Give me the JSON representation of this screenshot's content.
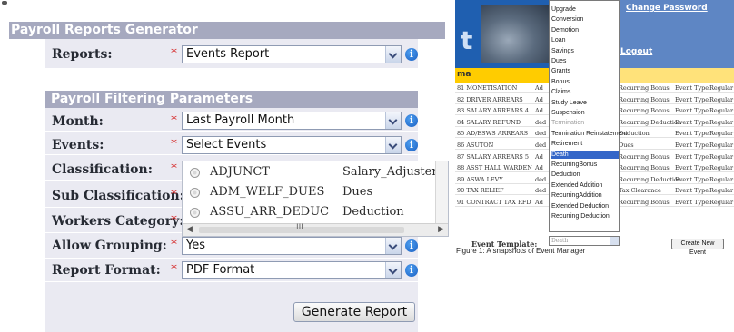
{
  "generator": {
    "title": "Payroll Reports Generator",
    "reports_label": "Reports:",
    "reports_value": "Events Report",
    "filter_title": "Payroll Filtering Parameters",
    "required_mark": "*",
    "info_glyph": "i",
    "fields": {
      "month": {
        "label": "Month:",
        "value": "Last Payroll Month"
      },
      "events": {
        "label": "Events:",
        "value": "Select Events"
      },
      "classification": {
        "label": "Classification:"
      },
      "sub_classification": {
        "label": "Sub Classification:"
      },
      "workers_category": {
        "label": "Workers Category:"
      },
      "allow_grouping": {
        "label": "Allow Grouping:",
        "value": "Yes"
      },
      "report_format": {
        "label": "Report Format:",
        "value": "PDF Format"
      }
    },
    "events_popup": [
      {
        "code": "ADJUNCT",
        "type": "Salary_Adjuster"
      },
      {
        "code": "ADM_WELF_DUES",
        "type": "Dues"
      },
      {
        "code": "ASSU_ARR_DEDUC",
        "type": "Deduction"
      }
    ],
    "popup_scroll_glyph": "III",
    "generate_button": "Generate Report"
  },
  "event_manager": {
    "change_password": "Change Password",
    "logout": "Logout",
    "section_stub": "ma",
    "rows": [
      {
        "code": "81 MONETISATION",
        "col2": "Ad",
        "col3": "Recurring Bonus",
        "col4": "Event Type",
        "col5": "Regular"
      },
      {
        "code": "82 DRIVER ARREARS",
        "col2": "Ad",
        "col3": "Recurring Bonus",
        "col4": "Event Type",
        "col5": "Regular"
      },
      {
        "code": "83 SALARY ARREARS 4",
        "col2": "Ad",
        "col3": "Recurring Bonus",
        "col4": "Event Type",
        "col5": "Regular"
      },
      {
        "code": "84 SALARY REFUND",
        "col2": "ded",
        "col3": "Recurring Deduction",
        "col4": "Event Type",
        "col5": "Regular"
      },
      {
        "code": "85 AD/ESWS ARREARS",
        "col2": "ded",
        "col3": "Deduction",
        "col4": "Event Type",
        "col5": "Regular"
      },
      {
        "code": "86 ASUTON",
        "col2": "ded",
        "col3": "Dues",
        "col4": "Event Type",
        "col5": "Regular"
      },
      {
        "code": "87 SALARY ARREARS 5",
        "col2": "Ad",
        "col3": "Recurring Bonus",
        "col4": "Event Type",
        "col5": "Regular"
      },
      {
        "code": "88 ASST HALL WARDEN",
        "col2": "Ad",
        "col3": "Recurring Bonus",
        "col4": "Event Type",
        "col5": "Regular"
      },
      {
        "code": "89 ASWA LEVY",
        "col2": "ded",
        "col3": "Recurring Deduction",
        "col4": "Event Type",
        "col5": "Regular"
      },
      {
        "code": "90 TAX RELIEF",
        "col2": "ded",
        "col3": "Tax Clearance",
        "col4": "Event Type",
        "col5": "Regular"
      },
      {
        "code": "91 CONTRACT TAX RFD",
        "col2": "Ad",
        "col3": "Recurring Bonus",
        "col4": "Event Type",
        "col5": "Regular"
      }
    ],
    "list_items": [
      "Upgrade",
      "Conversion",
      "Demotion",
      "Loan",
      "Savings",
      "Dues",
      "Grants",
      "Bonus",
      "Claims",
      "Study Leave",
      "Suspension",
      "Termination",
      "Termination Reinstatement",
      "Retirement",
      "Death",
      "RecurringBonus",
      "Deduction",
      "Extended Addition",
      "RecurringAddition",
      "Extended Deduction",
      "Recurring Deduction"
    ],
    "selected_item": "Death",
    "event_template_label": "Event Template:",
    "event_template_value": "Death",
    "create_button": "Create New Event",
    "caption": "Figure 1: A snapshots of Event Manager"
  }
}
